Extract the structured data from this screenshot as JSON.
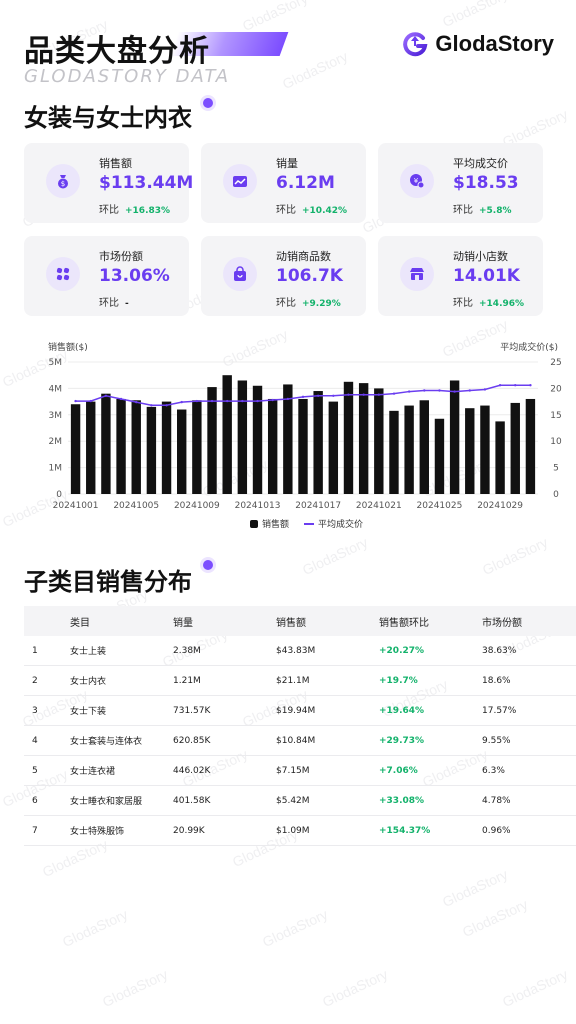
{
  "header": {
    "title": "品类大盘分析",
    "sub_brand": "GLODASTORY DATA",
    "logo_text": "GlodaStory"
  },
  "category_title": "女装与女士内衣",
  "kpis": [
    {
      "label": "销售额",
      "value": "$113.44M",
      "change_label": "环比",
      "change": "+16.83%",
      "icon": "money-bag-icon"
    },
    {
      "label": "销量",
      "value": "6.12M",
      "change_label": "环比",
      "change": "+10.42%",
      "icon": "trend-chart-icon"
    },
    {
      "label": "平均成交价",
      "value": "$18.53",
      "change_label": "环比",
      "change": "+5.8%",
      "icon": "price-tag-icon"
    },
    {
      "label": "市场份额",
      "value": "13.06%",
      "change_label": "环比",
      "change": "-",
      "icon": "share-grid-icon"
    },
    {
      "label": "动销商品数",
      "value": "106.7K",
      "change_label": "环比",
      "change": "+9.29%",
      "icon": "shopping-bag-icon"
    },
    {
      "label": "动销小店数",
      "value": "14.01K",
      "change_label": "环比",
      "change": "+14.96%",
      "icon": "store-icon"
    }
  ],
  "chart_data": {
    "type": "bar",
    "title": "",
    "ylabel": "销售额($)",
    "ylabel_right": "平均成交价($)",
    "ylim": [
      0,
      5000000
    ],
    "ylim_right": [
      0,
      25
    ],
    "yticks_left": [
      "0",
      "1M",
      "2M",
      "3M",
      "4M",
      "5M"
    ],
    "yticks_right": [
      "0",
      "5",
      "10",
      "15",
      "20",
      "25"
    ],
    "x_tick_labels": [
      "20241001",
      "20241005",
      "20241009",
      "20241013",
      "20241017",
      "20241021",
      "20241025",
      "20241029"
    ],
    "categories": [
      "20241001",
      "20241002",
      "20241003",
      "20241004",
      "20241005",
      "20241006",
      "20241007",
      "20241008",
      "20241009",
      "20241010",
      "20241011",
      "20241012",
      "20241013",
      "20241014",
      "20241015",
      "20241016",
      "20241017",
      "20241018",
      "20241019",
      "20241020",
      "20241021",
      "20241022",
      "20241023",
      "20241024",
      "20241025",
      "20241026",
      "20241027",
      "20241028",
      "20241029",
      "20241030",
      "20241031"
    ],
    "series": [
      {
        "name": "销售额",
        "kind": "bar",
        "color": "#111111",
        "values": [
          3400000,
          3500000,
          3800000,
          3600000,
          3550000,
          3300000,
          3500000,
          3200000,
          3550000,
          4050000,
          4500000,
          4300000,
          4100000,
          3600000,
          4150000,
          3600000,
          3900000,
          3500000,
          4250000,
          4200000,
          4000000,
          3150000,
          3350000,
          3550000,
          2850000,
          4300000,
          3250000,
          3350000,
          2750000,
          3450000,
          3600000
        ]
      },
      {
        "name": "平均成交价",
        "kind": "line",
        "color": "#6a3df0",
        "axis": "right",
        "values": [
          17.6,
          17.6,
          18.6,
          18.0,
          17.4,
          16.8,
          16.8,
          17.4,
          17.6,
          17.6,
          17.6,
          17.6,
          17.6,
          17.8,
          18.0,
          18.4,
          18.6,
          18.6,
          18.8,
          18.8,
          18.8,
          19.0,
          19.4,
          19.6,
          19.6,
          19.4,
          19.6,
          19.8,
          20.6,
          20.6,
          20.6
        ]
      }
    ],
    "legend_position": "bottom-center"
  },
  "subcategory_title": "子类目销售分布",
  "table": {
    "headers": [
      "",
      "类目",
      "销量",
      "销售额",
      "销售额环比",
      "市场份额"
    ],
    "rows": [
      [
        "1",
        "女士上装",
        "2.38M",
        "$43.83M",
        "+20.27%",
        "38.63%"
      ],
      [
        "2",
        "女士内衣",
        "1.21M",
        "$21.1M",
        "+19.7%",
        "18.6%"
      ],
      [
        "3",
        "女士下装",
        "731.57K",
        "$19.94M",
        "+19.64%",
        "17.57%"
      ],
      [
        "4",
        "女士套装与连体衣",
        "620.85K",
        "$10.84M",
        "+29.73%",
        "9.55%"
      ],
      [
        "5",
        "女士连衣裙",
        "446.02K",
        "$7.15M",
        "+7.06%",
        "6.3%"
      ],
      [
        "6",
        "女士睡衣和家居服",
        "401.58K",
        "$5.42M",
        "+33.08%",
        "4.78%"
      ],
      [
        "7",
        "女士特殊服饰",
        "20.99K",
        "$1.09M",
        "+154.37%",
        "0.96%"
      ]
    ]
  },
  "watermark": "GlodaStory",
  "colors": {
    "accent": "#6a3df0",
    "positive": "#13b26b",
    "bar": "#111111",
    "card_bg": "#f4f4f6"
  }
}
